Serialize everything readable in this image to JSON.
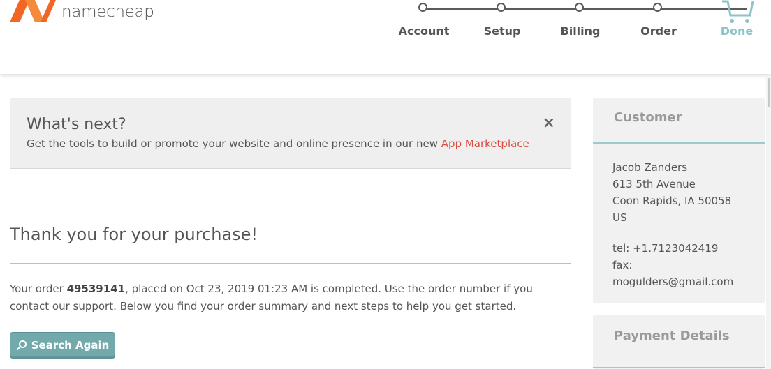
{
  "header": {
    "brand": "namecheap",
    "steps": [
      {
        "label": "Account"
      },
      {
        "label": "Setup"
      },
      {
        "label": "Billing"
      },
      {
        "label": "Order"
      },
      {
        "label": "Done"
      }
    ],
    "accent_color": "#8ec3c7",
    "logo_color": "#f26522"
  },
  "whats_next": {
    "title": "What's next?",
    "text": "Get the tools to build or promote your website and online presence in our new ",
    "link_label": "App Marketplace",
    "close_label": "×"
  },
  "thanks": {
    "title": "Thank you for your purchase!",
    "order_prefix": "Your order ",
    "order_number": "49539141",
    "order_suffix": ", placed on Oct 23, 2019 01:23 AM is completed. Use the order number if you contact our support. Below you find your order summary and next steps to help you get started.",
    "search_again_label": "Search Again"
  },
  "customer": {
    "heading": "Customer",
    "name": "Jacob Zanders",
    "street": "613 5th Avenue",
    "city": "Coon Rapids, IA 50058",
    "country": "US",
    "tel": "tel: +1.7123042419",
    "fax": "fax:",
    "email": "mogulders@gmail.com"
  },
  "payment": {
    "heading": "Payment Details"
  }
}
